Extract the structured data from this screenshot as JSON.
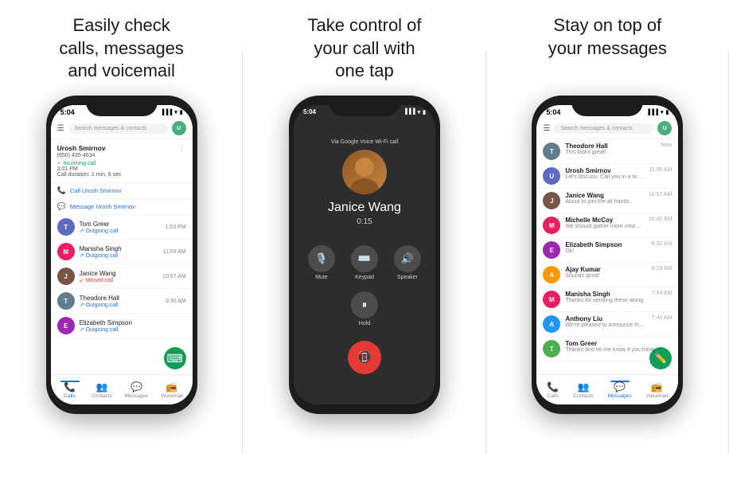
{
  "panels": [
    {
      "id": "panel1",
      "title": "Easily check\ncalls, messages\nand voicemail",
      "status_time": "5:04",
      "search_placeholder": "Search messages & contacts",
      "call_detail": {
        "name": "Urosh Smirnov",
        "number": "(650) 435-4634",
        "type": "Incoming call",
        "time": "3:01 PM",
        "duration": "Call duration: 1 min, 8 sec"
      },
      "actions": [
        {
          "icon": "📞",
          "label": "Call Urosh Smirnov"
        },
        {
          "icon": "💬",
          "label": "Message Urosh Smirnov"
        }
      ],
      "calls": [
        {
          "name": "Tom Greer",
          "type": "Outgoing call",
          "time": "1:53 PM",
          "color": "#5c6bc0"
        },
        {
          "name": "Manisha Singh",
          "type": "Outgoing call",
          "time": "11:58 AM",
          "color": "#e91e63"
        },
        {
          "name": "Janice Wang",
          "type": "Missed call",
          "time": "10:57 AM",
          "color": "#795548"
        },
        {
          "name": "Theodore Hall",
          "type": "Outgoing call",
          "time": "9:30 AM",
          "color": "#607d8b"
        },
        {
          "name": "Elizabeth Simpson",
          "type": "Outgoing call",
          "time": "",
          "color": "#9c27b0"
        }
      ],
      "nav": [
        {
          "label": "Calls",
          "icon": "📞",
          "active": true
        },
        {
          "label": "Contacts",
          "icon": "👥",
          "active": false
        },
        {
          "label": "Messages",
          "icon": "💬",
          "active": false
        },
        {
          "label": "Voicemail",
          "icon": "📻",
          "active": false
        }
      ]
    },
    {
      "id": "panel2",
      "title": "Take control of\nyour call with\none tap",
      "status_time": "5:04",
      "via_label": "Via Google Voice Wi-Fi call",
      "caller_name": "Janice Wang",
      "call_duration": "0:15",
      "controls": [
        {
          "icon": "🎤",
          "label": "Mute"
        },
        {
          "icon": "⌨️",
          "label": "Keypad"
        },
        {
          "icon": "🔊",
          "label": "Speaker"
        }
      ],
      "hold_label": "Hold"
    },
    {
      "id": "panel3",
      "title": "Stay on top of\nyour messages",
      "status_time": "5:04",
      "search_placeholder": "Search messages & contacts",
      "messages": [
        {
          "name": "Theodore Hall",
          "preview": "This looks great!",
          "time": "Now",
          "color": "#607d8b"
        },
        {
          "name": "Urosh Smirnov",
          "preview": "Let's discuss. Call you in a few minutes.",
          "time": "11:56 AM",
          "color": "#5c6bc0"
        },
        {
          "name": "Janice Wang",
          "preview": "About to join the all hands.",
          "time": "10:57 AM",
          "color": "#795548"
        },
        {
          "name": "Michelle McCoy",
          "preview": "We should gather more information on...",
          "time": "10:42 AM",
          "color": "#e91e63"
        },
        {
          "name": "Elizabeth Simpson",
          "preview": "Ok!",
          "time": "8:32 AM",
          "color": "#9c27b0"
        },
        {
          "name": "Ajay Kumar",
          "preview": "Sounds good!",
          "time": "8:03 AM",
          "color": "#ff9800"
        },
        {
          "name": "Manisha Singh",
          "preview": "Thanks for sending these along.",
          "time": "7:54 AM",
          "color": "#e91e63"
        },
        {
          "name": "Anthony Liu",
          "preview": "We're pleased to announce that we will...",
          "time": "7:40 AM",
          "color": "#2196f3"
        },
        {
          "name": "Tom Greer",
          "preview": "Thanks and let me know if you have...",
          "time": "",
          "color": "#4caf50"
        }
      ],
      "nav": [
        {
          "label": "Calls",
          "icon": "📞",
          "active": false
        },
        {
          "label": "Contacts",
          "icon": "👥",
          "active": false
        },
        {
          "label": "Messages",
          "icon": "💬",
          "active": true
        },
        {
          "label": "Voicemail",
          "icon": "📻",
          "active": false
        }
      ]
    }
  ]
}
